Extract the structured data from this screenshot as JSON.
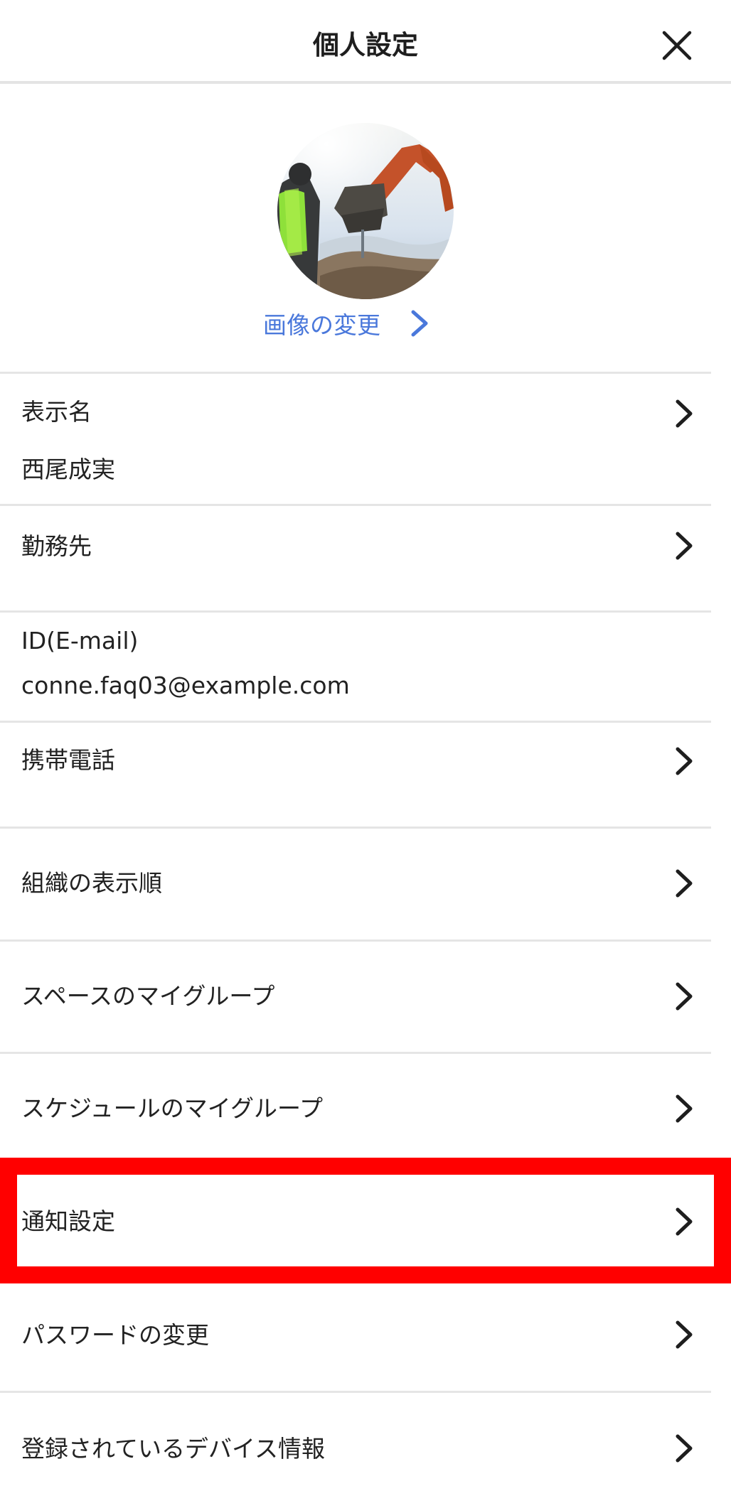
{
  "header": {
    "title": "個人設定"
  },
  "profile": {
    "change_image_label": "画像の変更"
  },
  "rows": [
    {
      "label": "表示名",
      "value": "西尾成実",
      "has_chevron": true
    },
    {
      "label": "勤務先",
      "value": "",
      "has_chevron": true
    },
    {
      "label": "ID(E-mail)",
      "value": "conne.faq03@example.com",
      "has_chevron": false
    },
    {
      "label": "携帯電話",
      "value": "",
      "has_chevron": true
    },
    {
      "label": "組織の表示順",
      "has_chevron": true
    },
    {
      "label": "スペースのマイグループ",
      "has_chevron": true
    },
    {
      "label": "スケジュールのマイグループ",
      "has_chevron": true
    },
    {
      "label": "通知設定",
      "has_chevron": true,
      "highlighted": true
    },
    {
      "label": "パスワードの変更",
      "has_chevron": true
    },
    {
      "label": "登録されているデバイス情報",
      "has_chevron": true
    }
  ],
  "colors": {
    "accent_link": "#4a78db",
    "highlight": "#ff0000",
    "divider": "#e5e5e5"
  },
  "icons": {
    "close": "close-icon",
    "chevron": "chevron-right-icon"
  }
}
